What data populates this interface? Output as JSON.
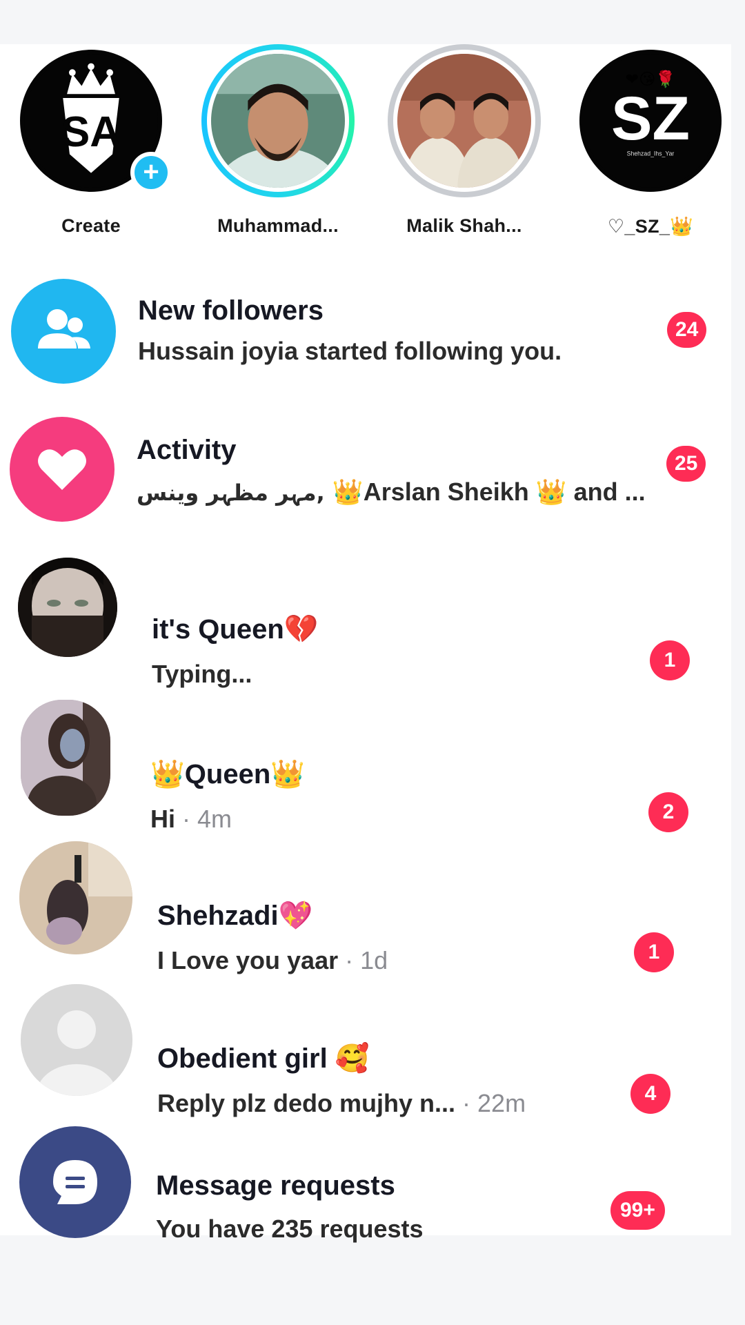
{
  "stories": [
    {
      "name": "Create",
      "logo_text": "SA",
      "ring": "none"
    },
    {
      "name": "Muhammad...",
      "ring": "live"
    },
    {
      "name": "Malik Shah...",
      "ring": "seen"
    },
    {
      "name": "♡_SZ_👑",
      "logo_text": "SZ",
      "logo_caption": "Shehzad_Ihs_Yar",
      "logo_emojis": "❤😘🌹",
      "ring": "none"
    }
  ],
  "rows": [
    {
      "title": "New followers",
      "subtitle": "Hussain joyia started following you.",
      "badge": "24",
      "icon": "people-icon"
    },
    {
      "title": "Activity",
      "subtitle_prefix": "مہر مظہر وینس, ",
      "subtitle_main": "👑Arslan Sheikh 👑 and ...",
      "badge": "25",
      "icon": "heart-icon"
    },
    {
      "title": "it's Queen💔",
      "subtitle": "Typing...",
      "time": "",
      "badge": "1"
    },
    {
      "title": "👑Queen👑",
      "subtitle": "Hi",
      "time": " · 4m",
      "badge": "2"
    },
    {
      "title": "Shehzadi💖",
      "subtitle": "I Love you yaar",
      "time": " · 1d",
      "badge": "1"
    },
    {
      "title": "Obedient girl 🥰",
      "subtitle": "Reply plz dedo mujhy n...",
      "time": " · 22m",
      "badge": "4"
    },
    {
      "title": "Message requests",
      "subtitle": "You have 235 requests",
      "badge": "99+",
      "icon": "message-icon"
    }
  ],
  "colors": {
    "followers_icon_bg": "#20b7f0",
    "activity_icon_bg": "#f53c7e",
    "requests_icon_bg": "#3b4a86",
    "badge": "#fe2c55"
  }
}
